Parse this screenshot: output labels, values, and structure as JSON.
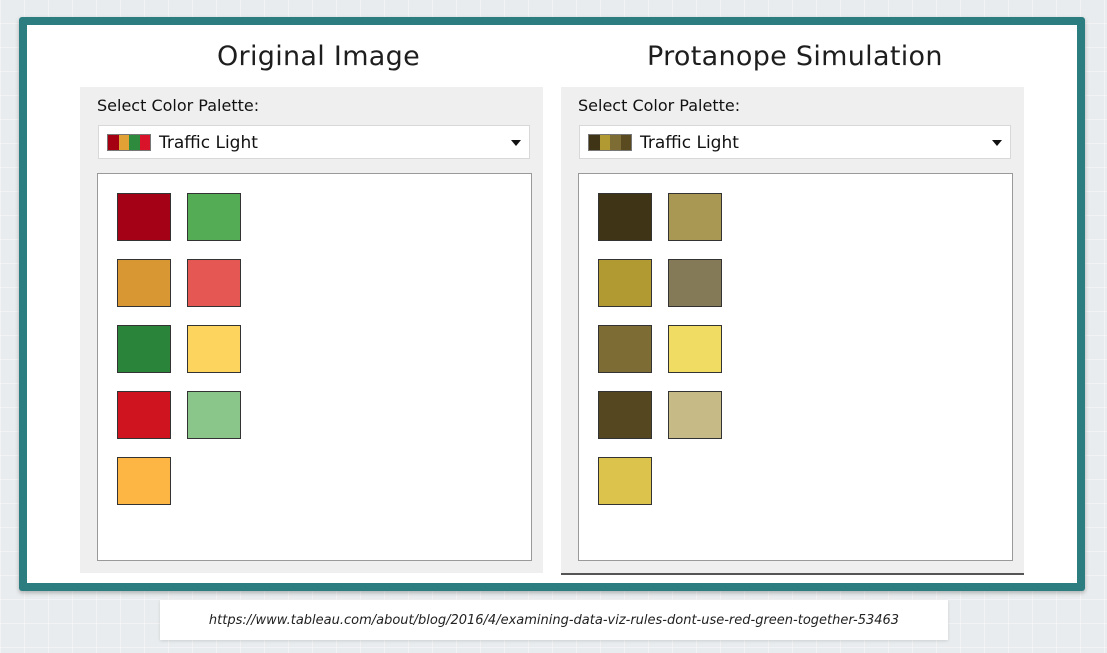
{
  "titles": {
    "left": "Original Image",
    "right": "Protanope Simulation"
  },
  "panels": {
    "left": {
      "label": "Select Color Palette:",
      "palette_name": "Traffic Light",
      "preview_colors": [
        "#a40012",
        "#e2a134",
        "#2e8b3d",
        "#d8132a"
      ],
      "swatches": [
        {
          "color": "#a40016",
          "col": 0,
          "row": 0
        },
        {
          "color": "#54ad54",
          "col": 1,
          "row": 0
        },
        {
          "color": "#d99733",
          "col": 0,
          "row": 1
        },
        {
          "color": "#e45753",
          "col": 1,
          "row": 1
        },
        {
          "color": "#2a8439",
          "col": 0,
          "row": 2
        },
        {
          "color": "#fdd55e",
          "col": 1,
          "row": 2
        },
        {
          "color": "#d0141f",
          "col": 0,
          "row": 3
        },
        {
          "color": "#8ac68a",
          "col": 1,
          "row": 3
        },
        {
          "color": "#fdb543",
          "col": 0,
          "row": 4
        }
      ]
    },
    "right": {
      "label": "Select Color Palette:",
      "palette_name": "Traffic Light",
      "preview_colors": [
        "#3f3516",
        "#b29a32",
        "#7e6c35",
        "#5a4a1f"
      ],
      "swatches": [
        {
          "color": "#3f3516",
          "col": 0,
          "row": 0
        },
        {
          "color": "#a89853",
          "col": 1,
          "row": 0
        },
        {
          "color": "#b29a32",
          "col": 0,
          "row": 1
        },
        {
          "color": "#857a57",
          "col": 1,
          "row": 1
        },
        {
          "color": "#7e6c35",
          "col": 0,
          "row": 2
        },
        {
          "color": "#f0dc62",
          "col": 1,
          "row": 2
        },
        {
          "color": "#554820",
          "col": 0,
          "row": 3
        },
        {
          "color": "#c6bb86",
          "col": 1,
          "row": 3
        },
        {
          "color": "#dcc44c",
          "col": 0,
          "row": 4
        }
      ]
    }
  },
  "source_url": "https://www.tableau.com/about/blog/2016/4/examining-data-viz-rules-dont-use-red-green-together-53463",
  "colors": {
    "frame": "#2b7d80",
    "panel_bg": "#efefef"
  }
}
